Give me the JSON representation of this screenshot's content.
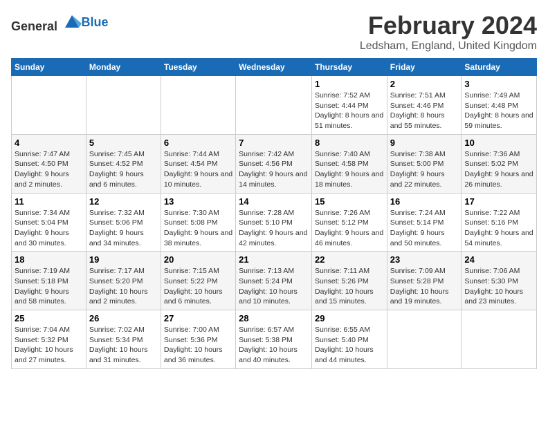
{
  "logo": {
    "text_general": "General",
    "text_blue": "Blue"
  },
  "title": {
    "month": "February 2024",
    "location": "Ledsham, England, United Kingdom"
  },
  "days_of_week": [
    "Sunday",
    "Monday",
    "Tuesday",
    "Wednesday",
    "Thursday",
    "Friday",
    "Saturday"
  ],
  "weeks": [
    [
      {
        "day": "",
        "info": ""
      },
      {
        "day": "",
        "info": ""
      },
      {
        "day": "",
        "info": ""
      },
      {
        "day": "",
        "info": ""
      },
      {
        "day": "1",
        "info": "Sunrise: 7:52 AM\nSunset: 4:44 PM\nDaylight: 8 hours and 51 minutes."
      },
      {
        "day": "2",
        "info": "Sunrise: 7:51 AM\nSunset: 4:46 PM\nDaylight: 8 hours and 55 minutes."
      },
      {
        "day": "3",
        "info": "Sunrise: 7:49 AM\nSunset: 4:48 PM\nDaylight: 8 hours and 59 minutes."
      }
    ],
    [
      {
        "day": "4",
        "info": "Sunrise: 7:47 AM\nSunset: 4:50 PM\nDaylight: 9 hours and 2 minutes."
      },
      {
        "day": "5",
        "info": "Sunrise: 7:45 AM\nSunset: 4:52 PM\nDaylight: 9 hours and 6 minutes."
      },
      {
        "day": "6",
        "info": "Sunrise: 7:44 AM\nSunset: 4:54 PM\nDaylight: 9 hours and 10 minutes."
      },
      {
        "day": "7",
        "info": "Sunrise: 7:42 AM\nSunset: 4:56 PM\nDaylight: 9 hours and 14 minutes."
      },
      {
        "day": "8",
        "info": "Sunrise: 7:40 AM\nSunset: 4:58 PM\nDaylight: 9 hours and 18 minutes."
      },
      {
        "day": "9",
        "info": "Sunrise: 7:38 AM\nSunset: 5:00 PM\nDaylight: 9 hours and 22 minutes."
      },
      {
        "day": "10",
        "info": "Sunrise: 7:36 AM\nSunset: 5:02 PM\nDaylight: 9 hours and 26 minutes."
      }
    ],
    [
      {
        "day": "11",
        "info": "Sunrise: 7:34 AM\nSunset: 5:04 PM\nDaylight: 9 hours and 30 minutes."
      },
      {
        "day": "12",
        "info": "Sunrise: 7:32 AM\nSunset: 5:06 PM\nDaylight: 9 hours and 34 minutes."
      },
      {
        "day": "13",
        "info": "Sunrise: 7:30 AM\nSunset: 5:08 PM\nDaylight: 9 hours and 38 minutes."
      },
      {
        "day": "14",
        "info": "Sunrise: 7:28 AM\nSunset: 5:10 PM\nDaylight: 9 hours and 42 minutes."
      },
      {
        "day": "15",
        "info": "Sunrise: 7:26 AM\nSunset: 5:12 PM\nDaylight: 9 hours and 46 minutes."
      },
      {
        "day": "16",
        "info": "Sunrise: 7:24 AM\nSunset: 5:14 PM\nDaylight: 9 hours and 50 minutes."
      },
      {
        "day": "17",
        "info": "Sunrise: 7:22 AM\nSunset: 5:16 PM\nDaylight: 9 hours and 54 minutes."
      }
    ],
    [
      {
        "day": "18",
        "info": "Sunrise: 7:19 AM\nSunset: 5:18 PM\nDaylight: 9 hours and 58 minutes."
      },
      {
        "day": "19",
        "info": "Sunrise: 7:17 AM\nSunset: 5:20 PM\nDaylight: 10 hours and 2 minutes."
      },
      {
        "day": "20",
        "info": "Sunrise: 7:15 AM\nSunset: 5:22 PM\nDaylight: 10 hours and 6 minutes."
      },
      {
        "day": "21",
        "info": "Sunrise: 7:13 AM\nSunset: 5:24 PM\nDaylight: 10 hours and 10 minutes."
      },
      {
        "day": "22",
        "info": "Sunrise: 7:11 AM\nSunset: 5:26 PM\nDaylight: 10 hours and 15 minutes."
      },
      {
        "day": "23",
        "info": "Sunrise: 7:09 AM\nSunset: 5:28 PM\nDaylight: 10 hours and 19 minutes."
      },
      {
        "day": "24",
        "info": "Sunrise: 7:06 AM\nSunset: 5:30 PM\nDaylight: 10 hours and 23 minutes."
      }
    ],
    [
      {
        "day": "25",
        "info": "Sunrise: 7:04 AM\nSunset: 5:32 PM\nDaylight: 10 hours and 27 minutes."
      },
      {
        "day": "26",
        "info": "Sunrise: 7:02 AM\nSunset: 5:34 PM\nDaylight: 10 hours and 31 minutes."
      },
      {
        "day": "27",
        "info": "Sunrise: 7:00 AM\nSunset: 5:36 PM\nDaylight: 10 hours and 36 minutes."
      },
      {
        "day": "28",
        "info": "Sunrise: 6:57 AM\nSunset: 5:38 PM\nDaylight: 10 hours and 40 minutes."
      },
      {
        "day": "29",
        "info": "Sunrise: 6:55 AM\nSunset: 5:40 PM\nDaylight: 10 hours and 44 minutes."
      },
      {
        "day": "",
        "info": ""
      },
      {
        "day": "",
        "info": ""
      }
    ]
  ]
}
